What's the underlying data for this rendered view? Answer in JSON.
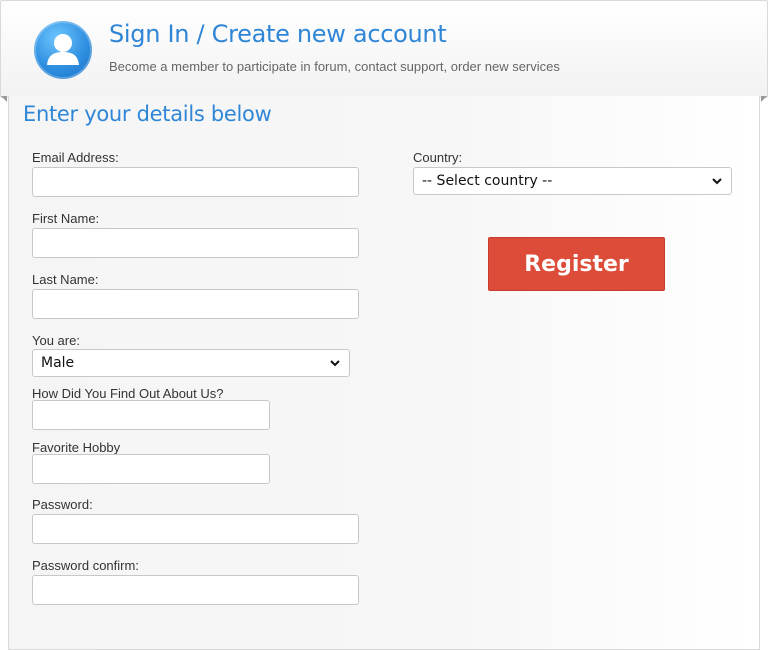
{
  "header": {
    "title": "Sign In / Create new account",
    "subtitle": "Become a member to participate in forum, contact support, order new services"
  },
  "form": {
    "section_title": "Enter your details below",
    "email_label": "Email Address:",
    "email_value": "",
    "first_name_label": "First Name:",
    "first_name_value": "",
    "last_name_label": "Last Name:",
    "last_name_value": "",
    "gender_label": "You are:",
    "gender_selected": "Male",
    "found_us_label": "How Did You Find Out About Us?",
    "found_us_value": "",
    "hobby_label": "Favorite Hobby",
    "hobby_value": "",
    "password_label": "Password:",
    "password_value": "",
    "password_confirm_label": "Password confirm:",
    "password_confirm_value": "",
    "country_label": "Country:",
    "country_selected": "-- Select country --",
    "register_label": "Register"
  },
  "colors": {
    "accent_blue": "#2f86d6",
    "register_red": "#dd4b39"
  },
  "icons": {
    "avatar": "user-avatar-icon",
    "dropdown": "chevron-down-icon"
  }
}
